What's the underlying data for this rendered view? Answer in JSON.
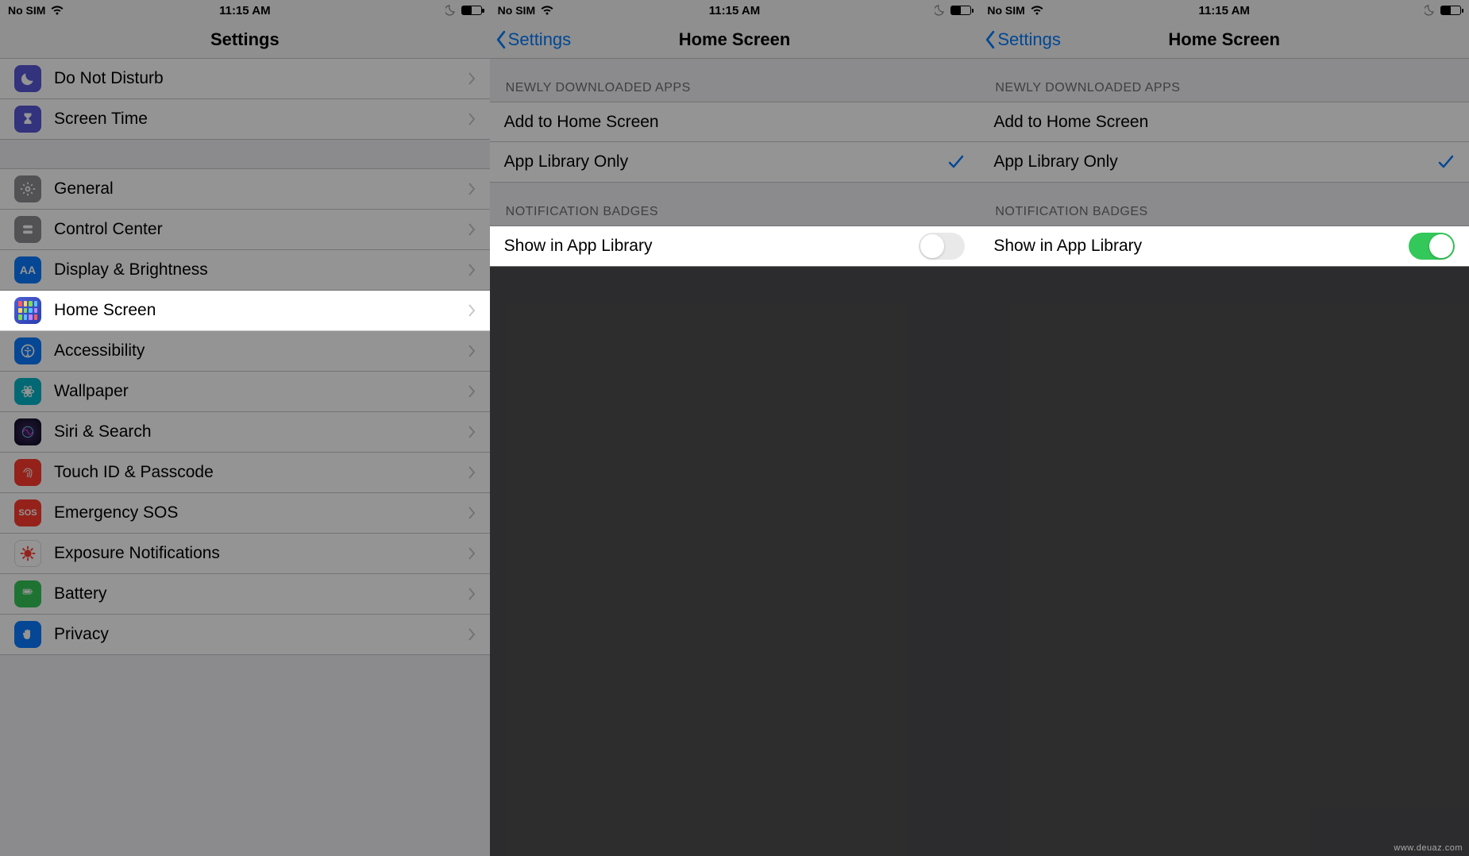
{
  "statusBar": {
    "carrier": "No SIM",
    "time": "11:15 AM",
    "batteryPct": 50
  },
  "screen1": {
    "title": "Settings",
    "items": [
      {
        "label": "Do Not Disturb",
        "iconBg": "#5856d6"
      },
      {
        "label": "Screen Time",
        "iconBg": "#5856d6"
      }
    ],
    "items2": [
      {
        "label": "General",
        "iconBg": "#8e8e93"
      },
      {
        "label": "Control Center",
        "iconBg": "#8e8e93"
      },
      {
        "label": "Display & Brightness",
        "iconBg": "#0a7aff",
        "text": "AA"
      },
      {
        "label": "Home Screen",
        "iconBg": "#3156c5"
      },
      {
        "label": "Accessibility",
        "iconBg": "#0a7aff"
      },
      {
        "label": "Wallpaper",
        "iconBg": "#05b6c9"
      },
      {
        "label": "Siri & Search",
        "iconBg": "#1b1a37"
      },
      {
        "label": "Touch ID & Passcode",
        "iconBg": "#ff3b30"
      },
      {
        "label": "Emergency SOS",
        "iconBg": "#ff3b30",
        "text": "SOS"
      },
      {
        "label": "Exposure Notifications",
        "iconBg": "#ff3b30"
      },
      {
        "label": "Battery",
        "iconBg": "#34c759"
      },
      {
        "label": "Privacy",
        "iconBg": "#0a7aff"
      }
    ]
  },
  "screen2": {
    "back": "Settings",
    "title": "Home Screen",
    "header1": "NEWLY DOWNLOADED APPS",
    "opt1": "Add to Home Screen",
    "opt2": "App Library Only",
    "header2": "NOTIFICATION BADGES",
    "toggleLabel": "Show in App Library",
    "toggleOn": false
  },
  "screen3": {
    "back": "Settings",
    "title": "Home Screen",
    "header1": "NEWLY DOWNLOADED APPS",
    "opt1": "Add to Home Screen",
    "opt2": "App Library Only",
    "header2": "NOTIFICATION BADGES",
    "toggleLabel": "Show in App Library",
    "toggleOn": true
  },
  "watermark": "www.deuaz.com"
}
